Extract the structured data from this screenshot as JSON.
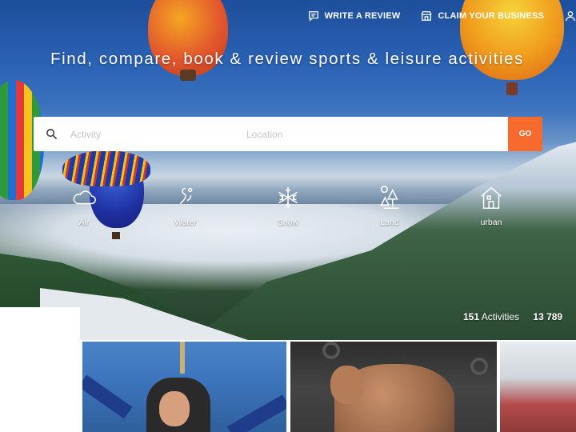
{
  "nav": {
    "write_review": "WRITE A REVIEW",
    "claim_business": "CLAIM YOUR BUSINESS"
  },
  "headline": "Find, compare, book & review sports & leisure activities",
  "search": {
    "activity_placeholder": "Activity",
    "location_placeholder": "Location",
    "go_label": "GO"
  },
  "categories": [
    {
      "label": "Air",
      "icon": "cloud-icon"
    },
    {
      "label": "Water",
      "icon": "water-icon"
    },
    {
      "label": "Snow",
      "icon": "snowflake-icon"
    },
    {
      "label": "Land",
      "icon": "trees-icon"
    },
    {
      "label": "urban",
      "icon": "house-icon"
    }
  ],
  "stats": {
    "activities_count": "151",
    "activities_label": "Activities",
    "second_count": "13 789"
  },
  "colors": {
    "accent": "#f66a2d",
    "sky": "#2a61b3"
  }
}
